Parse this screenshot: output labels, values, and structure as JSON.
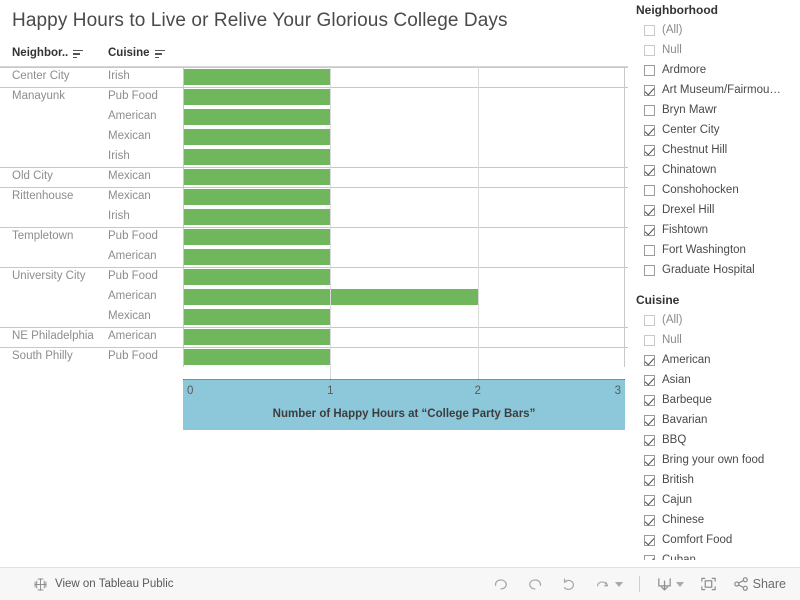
{
  "dashboard": {
    "title": "Happy  Hours to Live or Relive Your Glorious College Days"
  },
  "table": {
    "headers": {
      "neighborhood": "Neighbor..",
      "cuisine": "Cuisine"
    }
  },
  "chart_data": {
    "type": "bar",
    "title": "Happy  Hours to Live or Relive Your Glorious College Days",
    "xlabel": "Number of Happy Hours at “College Party Bars”",
    "ylabel": "",
    "xlim": [
      0,
      3
    ],
    "xticks": [
      "0",
      "1",
      "2",
      "3"
    ],
    "grid": true,
    "orientation": "horizontal",
    "bar_color": "#6fb65c",
    "axis_band_color": "#8cc8da",
    "categories": [
      "Center City – Irish",
      "Manayunk – Pub Food",
      "Manayunk – American",
      "Manayunk – Mexican",
      "Manayunk – Irish",
      "Old City – Mexican",
      "Rittenhouse – Mexican",
      "Rittenhouse – Irish",
      "Templetown – Pub Food",
      "Templetown – American",
      "University City – Pub Food",
      "University City – American",
      "University City – Mexican",
      "NE Philadelphia – American",
      "South Philly – Pub Food"
    ],
    "values": [
      1,
      1,
      1,
      1,
      1,
      1,
      1,
      1,
      1,
      1,
      1,
      2,
      1,
      1,
      1
    ],
    "rows": [
      {
        "neighborhood": "Center City",
        "cuisine": "Irish",
        "value": 1,
        "group_start": true
      },
      {
        "neighborhood": "Manayunk",
        "cuisine": "Pub Food",
        "value": 1,
        "group_start": true
      },
      {
        "neighborhood": "",
        "cuisine": "American",
        "value": 1,
        "group_start": false
      },
      {
        "neighborhood": "",
        "cuisine": "Mexican",
        "value": 1,
        "group_start": false
      },
      {
        "neighborhood": "",
        "cuisine": "Irish",
        "value": 1,
        "group_start": false
      },
      {
        "neighborhood": "Old City",
        "cuisine": "Mexican",
        "value": 1,
        "group_start": true
      },
      {
        "neighborhood": "Rittenhouse",
        "cuisine": "Mexican",
        "value": 1,
        "group_start": true
      },
      {
        "neighborhood": "",
        "cuisine": "Irish",
        "value": 1,
        "group_start": false
      },
      {
        "neighborhood": "Templetown",
        "cuisine": "Pub Food",
        "value": 1,
        "group_start": true
      },
      {
        "neighborhood": "",
        "cuisine": "American",
        "value": 1,
        "group_start": false
      },
      {
        "neighborhood": "University City",
        "cuisine": "Pub Food",
        "value": 1,
        "group_start": true
      },
      {
        "neighborhood": "",
        "cuisine": "American",
        "value": 2,
        "group_start": false
      },
      {
        "neighborhood": "",
        "cuisine": "Mexican",
        "value": 1,
        "group_start": false
      },
      {
        "neighborhood": "NE Philadelphia",
        "cuisine": "American",
        "value": 1,
        "group_start": true
      },
      {
        "neighborhood": "South Philly",
        "cuisine": "Pub Food",
        "value": 1,
        "group_start": true
      }
    ]
  },
  "filters": [
    {
      "name": "neighborhood",
      "title": "Neighborhood",
      "items": [
        {
          "label": "(All)",
          "checked": false,
          "muted": true
        },
        {
          "label": "Null",
          "checked": false,
          "muted": true
        },
        {
          "label": "Ardmore",
          "checked": false,
          "muted": false
        },
        {
          "label": "Art Museum/Fairmou…",
          "checked": true,
          "muted": false
        },
        {
          "label": "Bryn Mawr",
          "checked": false,
          "muted": false
        },
        {
          "label": "Center City",
          "checked": true,
          "muted": false
        },
        {
          "label": "Chestnut Hill",
          "checked": true,
          "muted": false
        },
        {
          "label": "Chinatown",
          "checked": true,
          "muted": false
        },
        {
          "label": "Conshohocken",
          "checked": false,
          "muted": false
        },
        {
          "label": "Drexel Hill",
          "checked": true,
          "muted": false
        },
        {
          "label": "Fishtown",
          "checked": true,
          "muted": false
        },
        {
          "label": "Fort Washington",
          "checked": false,
          "muted": false
        },
        {
          "label": "Graduate Hospital",
          "checked": false,
          "muted": false
        }
      ]
    },
    {
      "name": "cuisine",
      "title": "Cuisine",
      "items": [
        {
          "label": "(All)",
          "checked": false,
          "muted": true
        },
        {
          "label": "Null",
          "checked": false,
          "muted": true
        },
        {
          "label": "American",
          "checked": true,
          "muted": false
        },
        {
          "label": "Asian",
          "checked": true,
          "muted": false
        },
        {
          "label": "Barbeque",
          "checked": true,
          "muted": false
        },
        {
          "label": "Bavarian",
          "checked": true,
          "muted": false
        },
        {
          "label": "BBQ",
          "checked": true,
          "muted": false
        },
        {
          "label": "Bring your own food",
          "checked": true,
          "muted": false
        },
        {
          "label": "British",
          "checked": true,
          "muted": false
        },
        {
          "label": "Cajun",
          "checked": true,
          "muted": false
        },
        {
          "label": "Chinese",
          "checked": true,
          "muted": false
        },
        {
          "label": "Comfort Food",
          "checked": true,
          "muted": false
        },
        {
          "label": "Cuban",
          "checked": true,
          "muted": false
        }
      ]
    }
  ],
  "toolbar": {
    "view_on_tableau_public": "View on Tableau Public",
    "share_label": "Share"
  }
}
